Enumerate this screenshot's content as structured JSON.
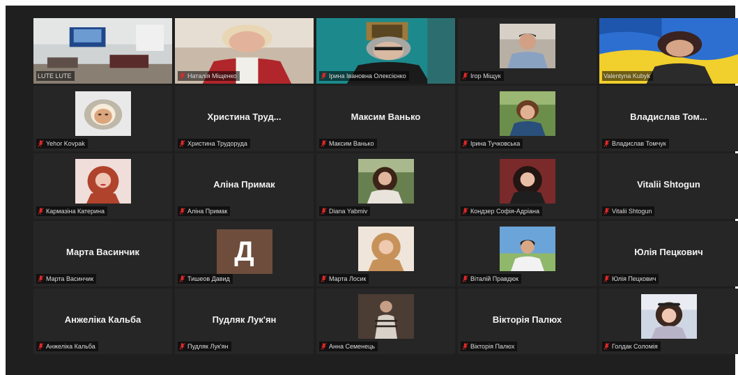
{
  "colors": {
    "background": "#1f1f1f",
    "tile": "#262626",
    "active_speaker_border": "#e8e34a",
    "mic_muted": "#e02828"
  },
  "participants": [
    {
      "display": "video",
      "tag": "LUTE LUTE",
      "muted": false,
      "scene": "classroom"
    },
    {
      "display": "video",
      "tag": "Наталія Міщенко",
      "muted": true,
      "scene": "blond-woman"
    },
    {
      "display": "video",
      "tag": "Ірина Івановна Олексієнко",
      "muted": true,
      "scene": "teal-wall"
    },
    {
      "display": "thumb",
      "tag": "Ігор Міщук",
      "muted": true,
      "scene": "man"
    },
    {
      "display": "video",
      "tag": "Valentyna Kubyk",
      "muted": false,
      "scene": "flag",
      "active": true
    },
    {
      "display": "thumb",
      "tag": "Yehor Kovpak",
      "muted": true,
      "scene": "hood"
    },
    {
      "display": "name",
      "big": "Христина Труд...",
      "tag": "Христина Трудоруда",
      "muted": true
    },
    {
      "display": "name",
      "big": "Максим Ванько",
      "tag": "Максим Ванько",
      "muted": true
    },
    {
      "display": "thumb",
      "tag": "Ірина Тучковська",
      "muted": true,
      "scene": "woman-green"
    },
    {
      "display": "name",
      "big": "Владислав Том...",
      "tag": "Владислав Томчук",
      "muted": true
    },
    {
      "display": "thumb",
      "tag": "Кармазіна Катерина",
      "muted": true,
      "scene": "redhead"
    },
    {
      "display": "name",
      "big": "Аліна Примак",
      "tag": "Аліна Примак",
      "muted": true
    },
    {
      "display": "thumb",
      "tag": "Diana Yabmiv",
      "muted": true,
      "scene": "dark-hair-outdoor"
    },
    {
      "display": "thumb",
      "tag": "Кондзер Софія-Адріана",
      "muted": true,
      "scene": "dark-hair-red"
    },
    {
      "display": "name",
      "big": "Vitalii Shtogun",
      "tag": "Vitalii Shtogun",
      "muted": true
    },
    {
      "display": "name",
      "big": "Марта Васинчик",
      "tag": "Марта Васинчик",
      "muted": true
    },
    {
      "display": "letter",
      "letter": "Д",
      "tag": "Тишеов Давид",
      "muted": true
    },
    {
      "display": "thumb",
      "tag": "Марта Лосик",
      "muted": true,
      "scene": "blonde"
    },
    {
      "display": "thumb",
      "tag": "Віталій Правдюк",
      "muted": true,
      "scene": "boy-sky"
    },
    {
      "display": "name",
      "big": "Юлія Пецкович",
      "tag": "Юлія Пецкович",
      "muted": true
    },
    {
      "display": "name",
      "big": "Анжеліка Кальба",
      "tag": "Анжеліка Кальба",
      "muted": true
    },
    {
      "display": "name",
      "big": "Пудляк Лук'ян",
      "tag": "Пудляк Лук'ян",
      "muted": true
    },
    {
      "display": "thumb",
      "tag": "Анна Семенець",
      "muted": true,
      "scene": "dark-photo"
    },
    {
      "display": "name",
      "big": "Вікторія Палюх",
      "tag": "Вікторія Палюх",
      "muted": true
    },
    {
      "display": "thumb",
      "tag": "Голдак Соломія",
      "muted": true,
      "scene": "girl-glasses"
    }
  ]
}
